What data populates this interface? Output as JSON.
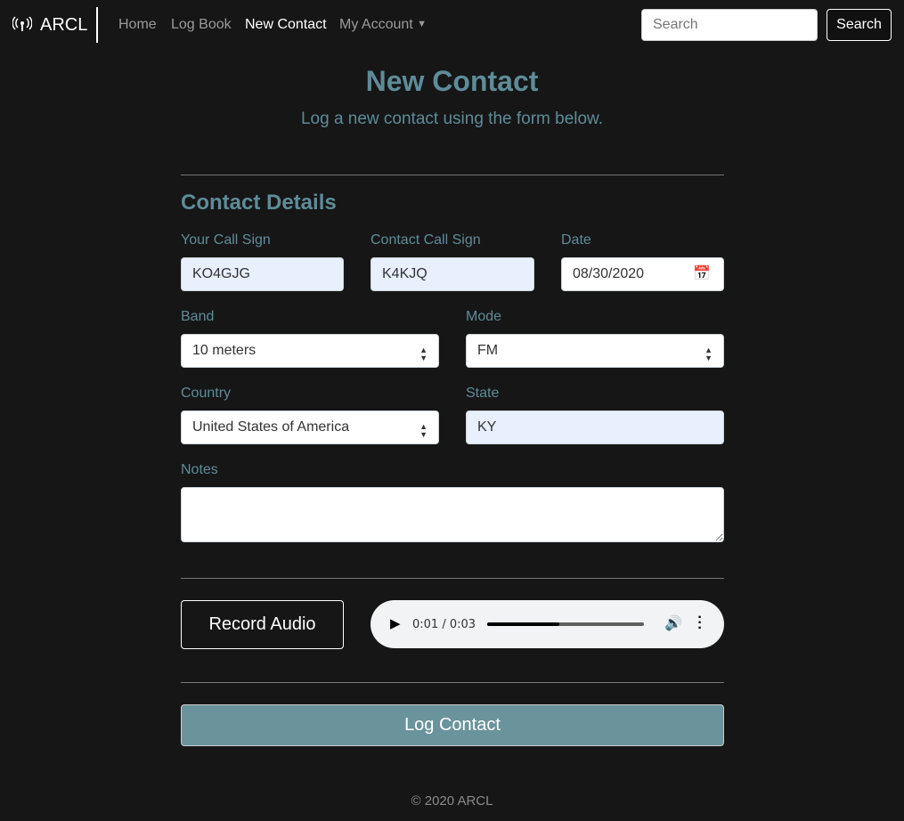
{
  "navbar": {
    "brand": "ARCL",
    "links": [
      "Home",
      "Log Book",
      "New Contact",
      "My Account"
    ],
    "active": "New Contact",
    "search_placeholder": "Search",
    "search_button": "Search"
  },
  "header": {
    "title": "New Contact",
    "subtitle": "Log a new contact using the form below."
  },
  "form": {
    "section_title": "Contact Details",
    "your_call_sign": {
      "label": "Your Call Sign",
      "value": "KO4GJG"
    },
    "contact_call_sign": {
      "label": "Contact Call Sign",
      "value": "K4KJQ"
    },
    "date": {
      "label": "Date",
      "value": "08/30/2020"
    },
    "band": {
      "label": "Band",
      "value": "10 meters"
    },
    "mode": {
      "label": "Mode",
      "value": "FM"
    },
    "country": {
      "label": "Country",
      "value": "United States of America"
    },
    "state": {
      "label": "State",
      "value": "KY"
    },
    "notes": {
      "label": "Notes",
      "value": ""
    }
  },
  "audio": {
    "record_label": "Record Audio",
    "time": "0:01 / 0:03",
    "progress_fraction": 0.46
  },
  "submit_label": "Log Contact",
  "footer": "© 2020 ARCL",
  "colors": {
    "accent": "#5e8c98",
    "button": "#6a939c",
    "background": "#161616"
  }
}
